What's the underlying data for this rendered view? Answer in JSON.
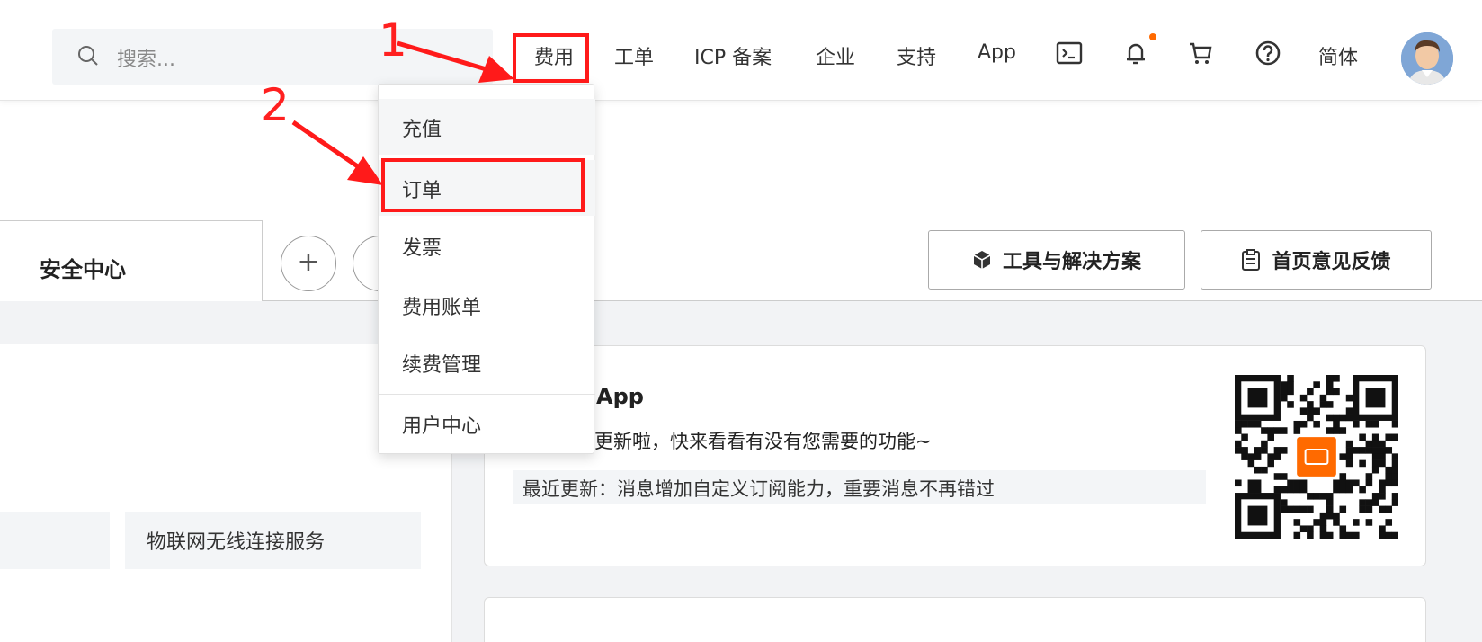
{
  "search": {
    "placeholder": "搜索..."
  },
  "nav": {
    "items": [
      {
        "label": "费用"
      },
      {
        "label": "工单"
      },
      {
        "label": "ICP 备案"
      },
      {
        "label": "企业"
      },
      {
        "label": "支持"
      },
      {
        "label": "App"
      },
      {
        "label": "简体"
      }
    ],
    "icons": [
      "terminal-icon",
      "bell-icon",
      "cart-icon",
      "help-icon",
      "avatar"
    ]
  },
  "dropdown": {
    "items": [
      {
        "label": "充值"
      },
      {
        "label": "订单"
      },
      {
        "label": "发票"
      },
      {
        "label": "费用账单"
      },
      {
        "label": "续费管理"
      },
      {
        "label": "用户中心"
      }
    ]
  },
  "tabs": {
    "active_label": "安全中心",
    "add_label": "+"
  },
  "toolbar": {
    "tools_label": "工具与解决方案",
    "feedback_label": "首页意见反馈"
  },
  "services": {
    "iot_label": "物联网无线连接服务"
  },
  "app_card": {
    "title": "App",
    "desc": "新的更新啦，快来看看有没有您需要的功能~",
    "update": "最近更新：消息增加自定义订阅能力，重要消息不再错过"
  },
  "annotations": {
    "step1": "1",
    "step2": "2"
  },
  "colors": {
    "accent": "#ff6a00",
    "annotation": "#ff1a1a"
  }
}
